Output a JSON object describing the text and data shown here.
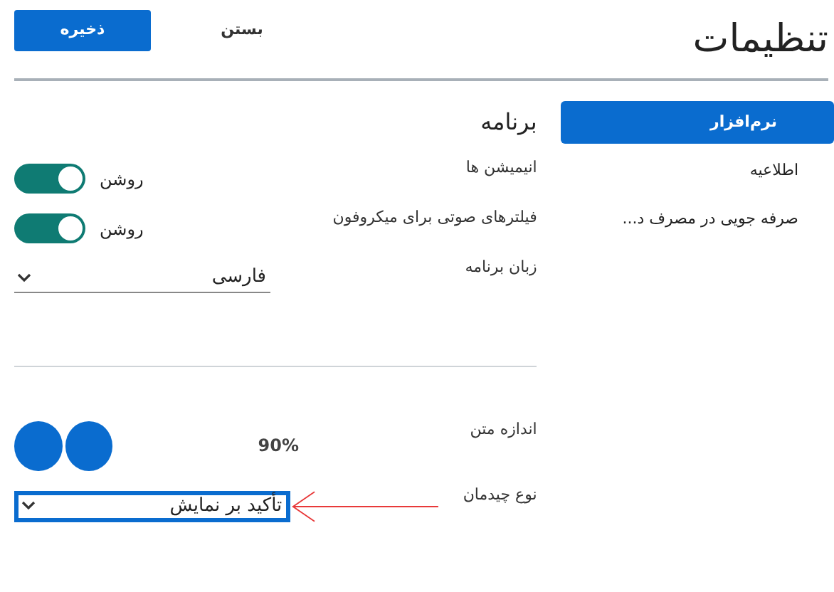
{
  "header": {
    "title": "تنظیمات",
    "buttons": [
      {
        "label": "بستن",
        "kind": "plain"
      },
      {
        "label": "ذخیره",
        "kind": "primary"
      }
    ]
  },
  "sidebar": {
    "items": [
      {
        "label": "نرم‌افزار",
        "selected": true
      },
      {
        "label": "اطلاعیه",
        "selected": false
      },
      {
        "label": "صرفه جویی در مصرف د...",
        "selected": false
      }
    ]
  },
  "section": {
    "title": "برنامه",
    "settings": [
      {
        "kind": "toggle",
        "label": "انیمیشن ها",
        "on": true,
        "state_text": "روشن"
      },
      {
        "kind": "toggle",
        "label": "فیلترهای صوتی برای میکروفون",
        "on": true,
        "state_text": "روشن"
      },
      {
        "kind": "select",
        "label": "زبان برنامه",
        "value": "فارسی",
        "focused": false
      }
    ]
  },
  "display": {
    "settings": [
      {
        "kind": "stepper",
        "label": "اندازه متن",
        "value": "90%"
      },
      {
        "kind": "select",
        "label": "نوع چیدمان",
        "value": "تأکید بر نمایش",
        "focused": true,
        "annotated": true
      }
    ]
  }
}
